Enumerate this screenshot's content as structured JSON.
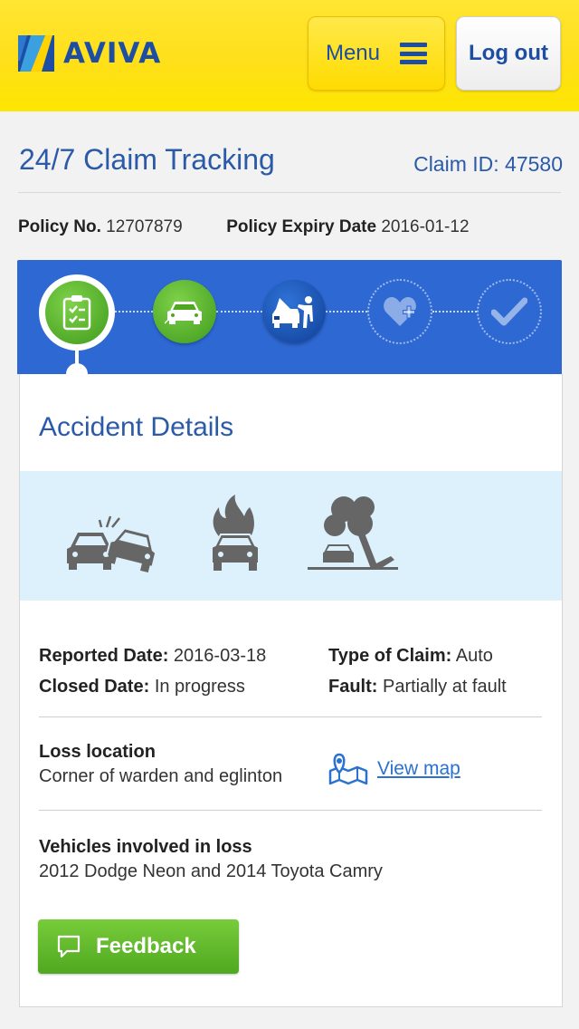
{
  "colors": {
    "brand_yellow": "#ffdf1a",
    "brand_blue": "#1d4ea3",
    "tracker_blue": "#2e68d3",
    "step_green": "#4fa81f",
    "incident_band": "#ddf1fc"
  },
  "header": {
    "logo_text": "AVIVA",
    "menu_label": "Menu",
    "logout_label": "Log out"
  },
  "page": {
    "title": "24/7 Claim Tracking",
    "claim_id": "Claim ID: 47580"
  },
  "policy": {
    "number_label": "Policy No.",
    "number_value": "12707879",
    "expiry_label": "Policy Expiry Date",
    "expiry_value": "2016-01-12"
  },
  "tracker": {
    "steps": [
      {
        "icon": "clipboard-icon",
        "state": "active"
      },
      {
        "icon": "car-crash-icon",
        "state": "complete"
      },
      {
        "icon": "mechanic-icon",
        "state": "current"
      },
      {
        "icon": "heart-plus-icon",
        "state": "pending"
      },
      {
        "icon": "checkmark-icon",
        "state": "pending"
      }
    ]
  },
  "accident": {
    "section_title": "Accident Details",
    "incident_icons": [
      "collision-icon",
      "car-fire-icon",
      "tree-fall-icon"
    ],
    "reported_label": "Reported Date:",
    "reported_value": "2016-03-18",
    "closed_label": "Closed Date:",
    "closed_value": "In progress",
    "claim_type_label": "Type of Claim:",
    "claim_type_value": "Auto",
    "fault_label": "Fault:",
    "fault_value": "Partially at fault",
    "loss_location_label": "Loss location",
    "loss_location_value": "Corner of warden and eglinton",
    "view_map_label": "View map",
    "vehicles_label": "Vehicles involved in loss",
    "vehicles_value": "2012 Dodge Neon and 2014 Toyota Camry",
    "feedback_label": "Feedback"
  }
}
